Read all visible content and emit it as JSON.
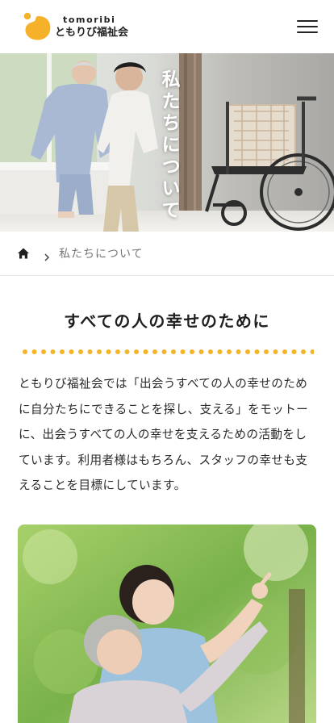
{
  "header": {
    "logo_en": "tomoribi",
    "logo_ja": "ともりび福祉会",
    "menu_icon": "hamburger-menu-icon"
  },
  "hero": {
    "title": "私たちについて"
  },
  "breadcrumb": {
    "home_icon": "home-icon",
    "separator_icon": "chevron-right-icon",
    "current": "私たちについて"
  },
  "section": {
    "title": "すべての人の幸せのために",
    "body": "ともりび福祉会では「出会うすべての人の幸せのために自分たちにできることを探し、支える」をモットーに、出会うすべての人の幸せを支えるための活動をしています。利用者様はもちろん、スタッフの幸せも支えることを目標にしています。"
  },
  "colors": {
    "brand_yellow": "#f6b12a",
    "dot_yellow": "#f4b42a",
    "text": "#2a2a2a"
  }
}
